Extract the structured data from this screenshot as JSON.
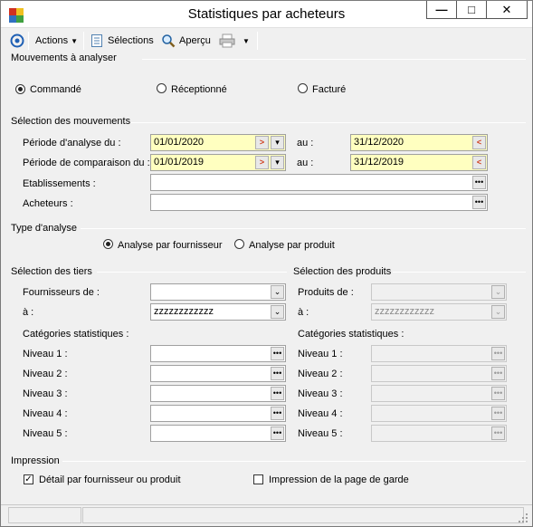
{
  "window": {
    "title": "Statistiques par acheteurs",
    "controls": {
      "minimize": "—",
      "maximize": "□",
      "close": "✕"
    }
  },
  "toolbar": {
    "actions_label": "Actions",
    "selections_label": "Sélections",
    "apercu_label": "Aperçu"
  },
  "mouvements_analyser": {
    "title": "Mouvements à analyser",
    "options": [
      {
        "label": "Commandé",
        "selected": true
      },
      {
        "label": "Réceptionné",
        "selected": false
      },
      {
        "label": "Facturé",
        "selected": false
      }
    ]
  },
  "selection_mouvements": {
    "title": "Sélection des mouvements",
    "periode_analyse_label": "Période d'analyse du :",
    "periode_analyse_from": "01/01/2020",
    "periode_analyse_to": "31/12/2020",
    "periode_comparaison_label": "Période de comparaison du :",
    "periode_comparaison_from": "01/01/2019",
    "periode_comparaison_to": "31/12/2019",
    "au_label": "au :",
    "etablissements_label": "Etablissements :",
    "etablissements_value": "",
    "acheteurs_label": "Acheteurs :",
    "acheteurs_value": ""
  },
  "type_analyse": {
    "title": "Type d'analyse",
    "options": [
      {
        "label": "Analyse par fournisseur",
        "selected": true
      },
      {
        "label": "Analyse par produit",
        "selected": false
      }
    ]
  },
  "selection_tiers": {
    "title": "Sélection des tiers",
    "fournisseurs_de_label": "Fournisseurs de :",
    "fournisseurs_de_value": "",
    "a_label": "à :",
    "a_value": "zzzzzzzzzzzz",
    "categories_label": "Catégories statistiques :",
    "niveaux": [
      {
        "label": "Niveau 1 :",
        "value": ""
      },
      {
        "label": "Niveau 2 :",
        "value": ""
      },
      {
        "label": "Niveau 3 :",
        "value": ""
      },
      {
        "label": "Niveau 4 :",
        "value": ""
      },
      {
        "label": "Niveau 5 :",
        "value": ""
      }
    ]
  },
  "selection_produits": {
    "title": "Sélection des produits",
    "produits_de_label": "Produits de :",
    "produits_de_value": "",
    "a_label": "à :",
    "a_value": "zzzzzzzzzzzz",
    "categories_label": "Catégories statistiques :",
    "niveaux": [
      {
        "label": "Niveau 1 :",
        "value": ""
      },
      {
        "label": "Niveau 2 :",
        "value": ""
      },
      {
        "label": "Niveau 3 :",
        "value": ""
      },
      {
        "label": "Niveau 4 :",
        "value": ""
      },
      {
        "label": "Niveau 5 :",
        "value": ""
      }
    ]
  },
  "impression": {
    "title": "Impression",
    "detail_label": "Détail par fournisseur ou produit",
    "detail_checked": true,
    "page_garde_label": "Impression de la page de garde",
    "page_garde_checked": false
  },
  "colors": {
    "date_field_bg": "#ffffc0",
    "accent_blue": "#1e5fb4"
  }
}
